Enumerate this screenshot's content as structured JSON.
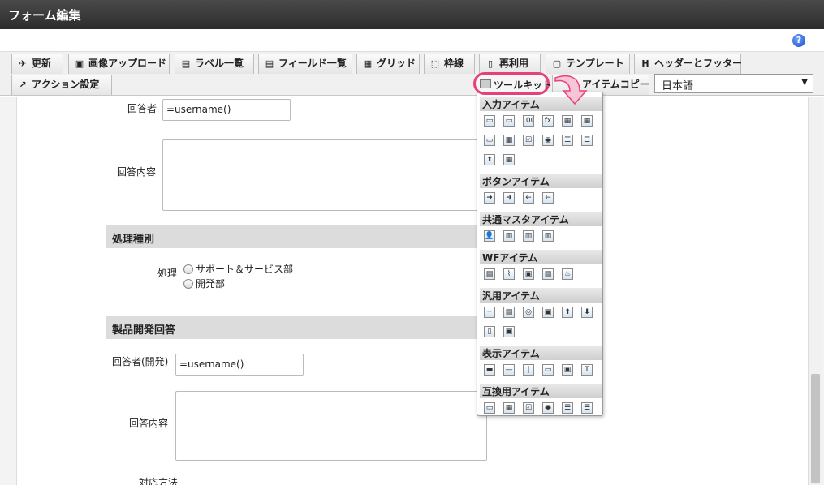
{
  "window": {
    "title": "フォーム編集"
  },
  "help": {
    "label": "?"
  },
  "toolbar": {
    "row1": [
      {
        "label": "更新",
        "icon": "✈"
      },
      {
        "label": "画像アップロード",
        "icon": "▣"
      },
      {
        "label": "ラベル一覧",
        "icon": "▤"
      },
      {
        "label": "フィールド一覧",
        "icon": "▤"
      },
      {
        "label": "グリッド",
        "icon": "▦"
      },
      {
        "label": "枠線",
        "icon": "⬚"
      },
      {
        "label": "再利用",
        "icon": "▯"
      },
      {
        "label": "テンプレート",
        "icon": "▢"
      },
      {
        "label": "ヘッダーとフッター",
        "icon": "H"
      }
    ],
    "action_setting": "アクション設定",
    "toolkit": "ツールキット",
    "item_copy": "アイテムコピー",
    "language": "日本語"
  },
  "form": {
    "responder_label": "回答者",
    "responder_value": "=username()",
    "content_label": "回答内容",
    "section1": "処理種別",
    "process_label": "処理",
    "process_options": [
      "サポート＆サービス部",
      "開発部"
    ],
    "section2": "製品開発回答",
    "dev_responder_label": "回答者(開発)",
    "dev_responder_value": "=username()",
    "dev_content_label": "回答内容",
    "method_label": "対応方法"
  },
  "toolkit_panel": {
    "sections": [
      {
        "title": "入力アイテム",
        "rows": [
          [
            "▭",
            "▭",
            ".00",
            "fx",
            "▦",
            "▦"
          ],
          [
            "▭",
            "▦",
            "☑",
            "◉",
            "☰",
            "☰"
          ],
          [
            "⬆",
            "▦"
          ]
        ]
      },
      {
        "title": "ボタンアイテム",
        "rows": [
          [
            "➜",
            "➜",
            "←",
            "←"
          ]
        ]
      },
      {
        "title": "共通マスタアイテム",
        "rows": [
          [
            "👤",
            "▥",
            "▥",
            "▥"
          ]
        ]
      },
      {
        "title": "WFアイテム",
        "rows": [
          [
            "▤",
            "⌇",
            "▣",
            "▤",
            "♨"
          ]
        ]
      },
      {
        "title": "汎用アイテム",
        "rows": [
          [
            "┄",
            "▤",
            "◎",
            "▣",
            "⬆",
            "⬇"
          ],
          [
            "▯",
            "▣"
          ]
        ]
      },
      {
        "title": "表示アイテム",
        "rows": [
          [
            "▬",
            "—",
            "|",
            "▭",
            "▣",
            "T"
          ]
        ]
      },
      {
        "title": "互換用アイテム",
        "rows": [
          [
            "▭",
            "▦",
            "☑",
            "◉",
            "☰",
            "☰"
          ]
        ]
      }
    ]
  },
  "colors": {
    "highlight": "#e8407a",
    "titlebar": "#333333"
  }
}
